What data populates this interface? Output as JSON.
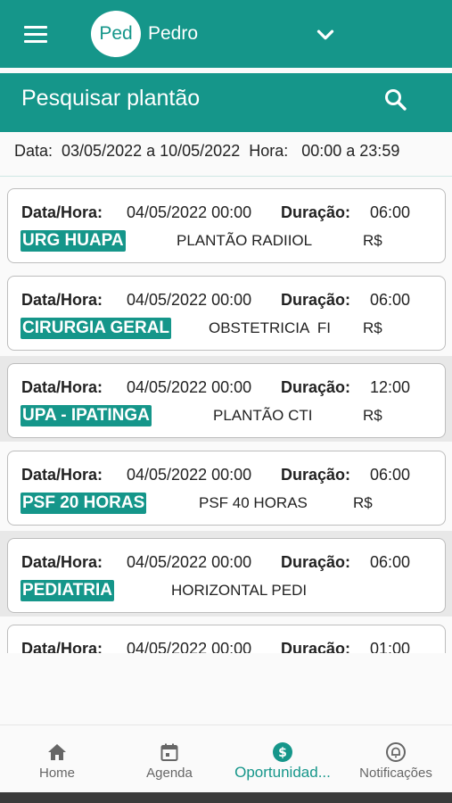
{
  "header": {
    "avatar_initials": "Ped",
    "user_name": "Pedro",
    "menu_icon": "menu-icon",
    "dropdown_icon": "chevron-down-icon"
  },
  "title_bar": {
    "title": "Pesquisar plantão",
    "search_icon": "search-icon"
  },
  "filter": {
    "text": "Data:  03/05/2022 a 10/05/2022  Hora:   00:00 a 23:59"
  },
  "labels": {
    "datetime": "Data/Hora:",
    "duration": "Duração:"
  },
  "cards": [
    {
      "datetime": "04/05/2022 00:00",
      "duration": "06:00",
      "tag": "URG HUAPA",
      "description": "PLANTÃO RADIIOL",
      "price": "R$"
    },
    {
      "datetime": "04/05/2022 00:00",
      "duration": "06:00",
      "tag": "CIRURGIA GERAL",
      "description": "OBSTETRICIA  FI",
      "price": "R$"
    },
    {
      "datetime": "04/05/2022 00:00",
      "duration": "12:00",
      "tag": "UPA - IPATINGA",
      "description": "PLANTÃO CTI",
      "price": "R$"
    },
    {
      "datetime": "04/05/2022 00:00",
      "duration": "06:00",
      "tag": "PSF 20 HORAS",
      "description": "PSF 40 HORAS",
      "price": "R$"
    },
    {
      "datetime": "04/05/2022 00:00",
      "duration": "06:00",
      "tag": "PEDIATRIA",
      "description": "HORIZONTAL PEDI",
      "price": ""
    },
    {
      "datetime": "04/05/2022 00:00",
      "duration": "01:00",
      "tag": "",
      "description": "",
      "price": ""
    }
  ],
  "bottom_nav": [
    {
      "label": "Home",
      "icon": "home-icon",
      "active": false
    },
    {
      "label": "Agenda",
      "icon": "calendar-icon",
      "active": false
    },
    {
      "label": "Oportunidad...",
      "icon": "dollar-icon",
      "active": true
    },
    {
      "label": "Notificações",
      "icon": "bell-icon",
      "active": false
    }
  ],
  "colors": {
    "primary": "#15968a",
    "background": "#fafafa",
    "card_border": "#bdbdbd"
  }
}
